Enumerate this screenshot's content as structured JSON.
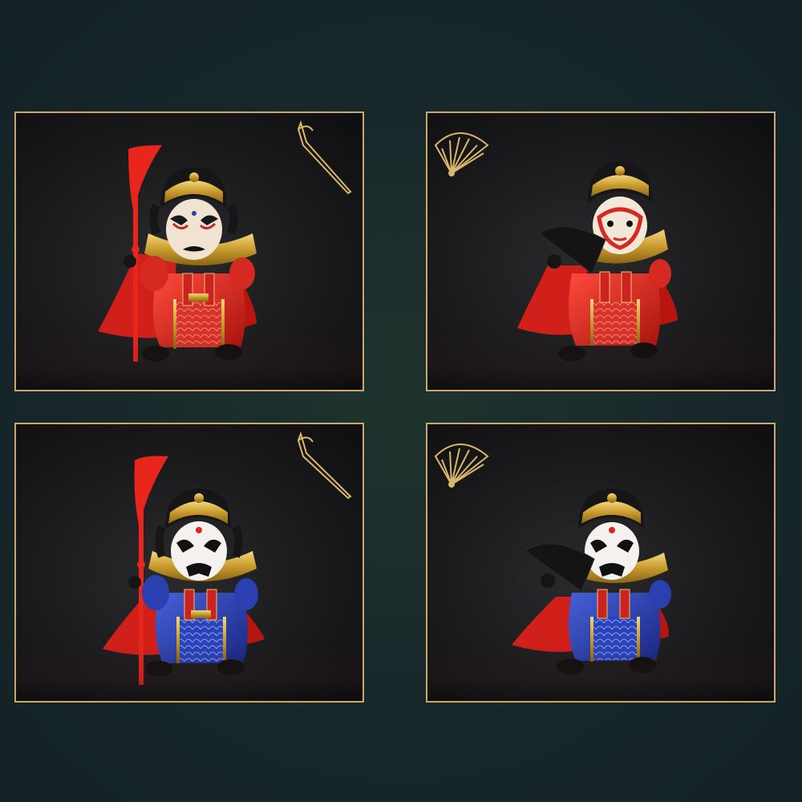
{
  "gallery": {
    "panels": [
      {
        "prop": "guandao-blade",
        "prop_icon": "blade-outline-icon",
        "robe": "red",
        "face": "red-black-mask"
      },
      {
        "prop": "folding-fan",
        "prop_icon": "fan-outline-icon",
        "robe": "red",
        "face": "monkey-mask"
      },
      {
        "prop": "guandao-blade",
        "prop_icon": "blade-outline-icon",
        "robe": "blue",
        "face": "white-black-mask"
      },
      {
        "prop": "folding-fan",
        "prop_icon": "fan-outline-icon",
        "robe": "blue",
        "face": "white-black-mask"
      }
    ],
    "colors": {
      "border_gold": "#c9a86a",
      "robe_red": "#d42a22",
      "robe_blue": "#2a3fb0",
      "cape_red": "#d11f1a",
      "gold": "#d9b24a",
      "background": "#182a2b"
    }
  }
}
